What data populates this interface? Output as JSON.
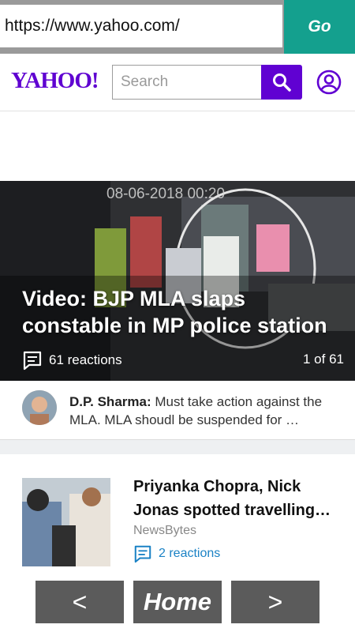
{
  "browser": {
    "url": "https://www.yahoo.com/",
    "go_label": "Go"
  },
  "header": {
    "logo": "YAHOO!",
    "search_placeholder": "Search",
    "colors": {
      "brand": "#6001d2"
    }
  },
  "hero": {
    "timestamp_overlay": "08-06-2018 00:20",
    "title": "Video: BJP MLA slaps constable in MP police station",
    "reactions": "61 reactions",
    "counter": "1 of 61"
  },
  "comment": {
    "author": "D.P. Sharma:",
    "text": "Must take action against the MLA. MLA shoudl be suspended for …"
  },
  "article": {
    "title": "Priyanka Chopra, Nick Jonas spotted travelling…",
    "source": "NewsBytes",
    "reactions": "2 reactions"
  },
  "nav": {
    "prev": "<",
    "home": "Home",
    "next": ">"
  }
}
